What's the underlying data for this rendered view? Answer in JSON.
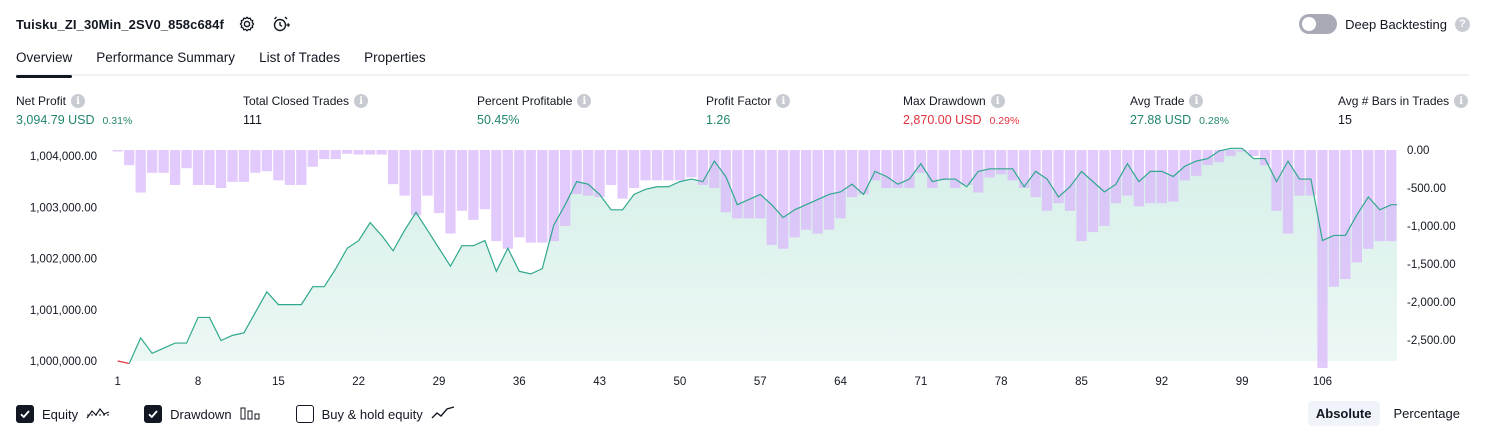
{
  "header": {
    "strategy_name": "Tuisku_ZI_30Min_2SV0_858c684f",
    "deep_backtesting_label": "Deep Backtesting",
    "deep_backtesting_on": false
  },
  "tabs": [
    {
      "label": "Overview",
      "active": true
    },
    {
      "label": "Performance Summary",
      "active": false
    },
    {
      "label": "List of Trades",
      "active": false
    },
    {
      "label": "Properties",
      "active": false
    }
  ],
  "metrics": [
    {
      "label": "Net Profit",
      "value": "3,094.79 USD",
      "pct": "0.31%",
      "tone": "green"
    },
    {
      "label": "Total Closed Trades",
      "value": "111",
      "pct": "",
      "tone": "dark"
    },
    {
      "label": "Percent Profitable",
      "value": "50.45%",
      "pct": "",
      "tone": "green"
    },
    {
      "label": "Profit Factor",
      "value": "1.26",
      "pct": "",
      "tone": "green"
    },
    {
      "label": "Max Drawdown",
      "value": "2,870.00 USD",
      "pct": "0.29%",
      "tone": "red"
    },
    {
      "label": "Avg Trade",
      "value": "27.88 USD",
      "pct": "0.28%",
      "tone": "green"
    },
    {
      "label": "Avg # Bars in Trades",
      "value": "15",
      "pct": "",
      "tone": "dark"
    }
  ],
  "colors": {
    "equity_line": "#2fa88d",
    "equity_fill": "#d6efe8",
    "drawdown_bar": "#d9b8fb",
    "negative_start": "#e0323e"
  },
  "chart_data": {
    "type": "line",
    "x_ticks": [
      1,
      8,
      15,
      22,
      29,
      36,
      43,
      50,
      57,
      64,
      71,
      78,
      85,
      92,
      99,
      106
    ],
    "y_left_ticks": [
      "1,000,000.00",
      "1,001,000.00",
      "1,002,000.00",
      "1,003,000.00",
      "1,004,000.00"
    ],
    "y_left_range": [
      1000000,
      1004000
    ],
    "y_right_ticks": [
      "0.00",
      "-500.00",
      "-1,000.00",
      "-1,500.00",
      "-2,000.00",
      "-2,500.00"
    ],
    "y_right_range": [
      -2870,
      0
    ],
    "series": [
      {
        "name": "Equity",
        "x": [
          1,
          2,
          3,
          4,
          5,
          6,
          7,
          8,
          9,
          10,
          11,
          12,
          13,
          14,
          15,
          16,
          17,
          18,
          19,
          20,
          21,
          22,
          23,
          24,
          25,
          26,
          27,
          28,
          29,
          30,
          31,
          32,
          33,
          34,
          35,
          36,
          37,
          38,
          39,
          40,
          41,
          42,
          43,
          44,
          45,
          46,
          47,
          48,
          49,
          50,
          51,
          52,
          53,
          54,
          55,
          56,
          57,
          58,
          59,
          60,
          61,
          62,
          63,
          64,
          65,
          66,
          67,
          68,
          69,
          70,
          71,
          72,
          73,
          74,
          75,
          76,
          77,
          78,
          79,
          80,
          81,
          82,
          83,
          84,
          85,
          86,
          87,
          88,
          89,
          90,
          91,
          92,
          93,
          94,
          95,
          96,
          97,
          98,
          99,
          100,
          101,
          102,
          103,
          104,
          105,
          106,
          107,
          108,
          109,
          110,
          111,
          112
        ],
        "values": [
          1000000,
          999950,
          1000450,
          1000150,
          1000250,
          1000350,
          1000350,
          1000850,
          1000850,
          1000400,
          1000500,
          1000550,
          1000950,
          1001350,
          1001100,
          1001100,
          1001100,
          1001450,
          1001450,
          1001800,
          1002200,
          1002350,
          1002700,
          1002450,
          1002150,
          1002550,
          1002900,
          1002550,
          1002200,
          1001850,
          1002250,
          1002250,
          1002350,
          1001750,
          1002200,
          1001750,
          1001700,
          1001800,
          1002650,
          1003050,
          1003500,
          1003450,
          1003250,
          1002950,
          1002950,
          1003250,
          1003350,
          1003400,
          1003400,
          1003500,
          1003550,
          1003500,
          1003900,
          1003600,
          1003050,
          1003150,
          1003250,
          1003050,
          1002800,
          1002950,
          1003050,
          1003150,
          1003250,
          1003300,
          1003450,
          1003250,
          1003700,
          1003600,
          1003450,
          1003550,
          1003850,
          1003500,
          1003550,
          1003550,
          1003400,
          1003700,
          1003750,
          1003750,
          1003750,
          1003400,
          1003700,
          1003550,
          1003200,
          1003400,
          1003700,
          1003500,
          1003300,
          1003450,
          1003850,
          1003500,
          1003700,
          1003700,
          1003600,
          1003800,
          1003900,
          1003950,
          1004100,
          1004150,
          1004150,
          1003950,
          1003950,
          1003500,
          1003900,
          1003550,
          1003550,
          1002350,
          1002450,
          1002450,
          1002850,
          1003200,
          1002950,
          1003050
        ]
      },
      {
        "name": "Drawdown",
        "x": [
          1,
          2,
          3,
          4,
          5,
          6,
          7,
          8,
          9,
          10,
          11,
          12,
          13,
          14,
          15,
          16,
          17,
          18,
          19,
          20,
          21,
          22,
          23,
          24,
          25,
          26,
          27,
          28,
          29,
          30,
          31,
          32,
          33,
          34,
          35,
          36,
          37,
          38,
          39,
          40,
          41,
          42,
          43,
          44,
          45,
          46,
          47,
          48,
          49,
          50,
          51,
          52,
          53,
          54,
          55,
          56,
          57,
          58,
          59,
          60,
          61,
          62,
          63,
          64,
          65,
          66,
          67,
          68,
          69,
          70,
          71,
          72,
          73,
          74,
          75,
          76,
          77,
          78,
          79,
          80,
          81,
          82,
          83,
          84,
          85,
          86,
          87,
          88,
          89,
          90,
          91,
          92,
          93,
          94,
          95,
          96,
          97,
          98,
          99,
          100,
          101,
          102,
          103,
          104,
          105,
          106,
          107,
          108,
          109,
          110,
          111,
          112
        ],
        "values": [
          -20,
          -200,
          -560,
          -300,
          -300,
          -460,
          -240,
          -460,
          -460,
          -500,
          -420,
          -420,
          -300,
          -280,
          -400,
          -460,
          -460,
          -220,
          -120,
          -120,
          -50,
          -60,
          -60,
          -60,
          -450,
          -600,
          -860,
          -600,
          -830,
          -1100,
          -800,
          -920,
          -780,
          -1200,
          -1300,
          -1150,
          -1220,
          -1220,
          -1200,
          -1000,
          -580,
          -600,
          -620,
          -460,
          -640,
          -500,
          -400,
          -400,
          -400,
          -400,
          -360,
          -460,
          -500,
          -820,
          -900,
          -900,
          -900,
          -1250,
          -1300,
          -1150,
          -1050,
          -1100,
          -1050,
          -900,
          -620,
          -580,
          -400,
          -500,
          -500,
          -500,
          -300,
          -500,
          -400,
          -500,
          -460,
          -560,
          -360,
          -320,
          -400,
          -500,
          -620,
          -800,
          -700,
          -800,
          -1200,
          -1080,
          -1000,
          -700,
          -600,
          -740,
          -700,
          -700,
          -680,
          -400,
          -340,
          -200,
          -160,
          -80,
          -20,
          -80,
          -200,
          -800,
          -1100,
          -600,
          -600,
          -2870,
          -1800,
          -1700,
          -1480,
          -1300,
          -1200,
          -1200
        ]
      }
    ],
    "legend": [
      {
        "name": "Equity",
        "checked": true
      },
      {
        "name": "Drawdown",
        "checked": true
      },
      {
        "name": "Buy & hold equity",
        "checked": false
      }
    ],
    "grid": false
  },
  "footer": {
    "mode_absolute": "Absolute",
    "mode_percentage": "Percentage",
    "active_mode": "Absolute"
  }
}
